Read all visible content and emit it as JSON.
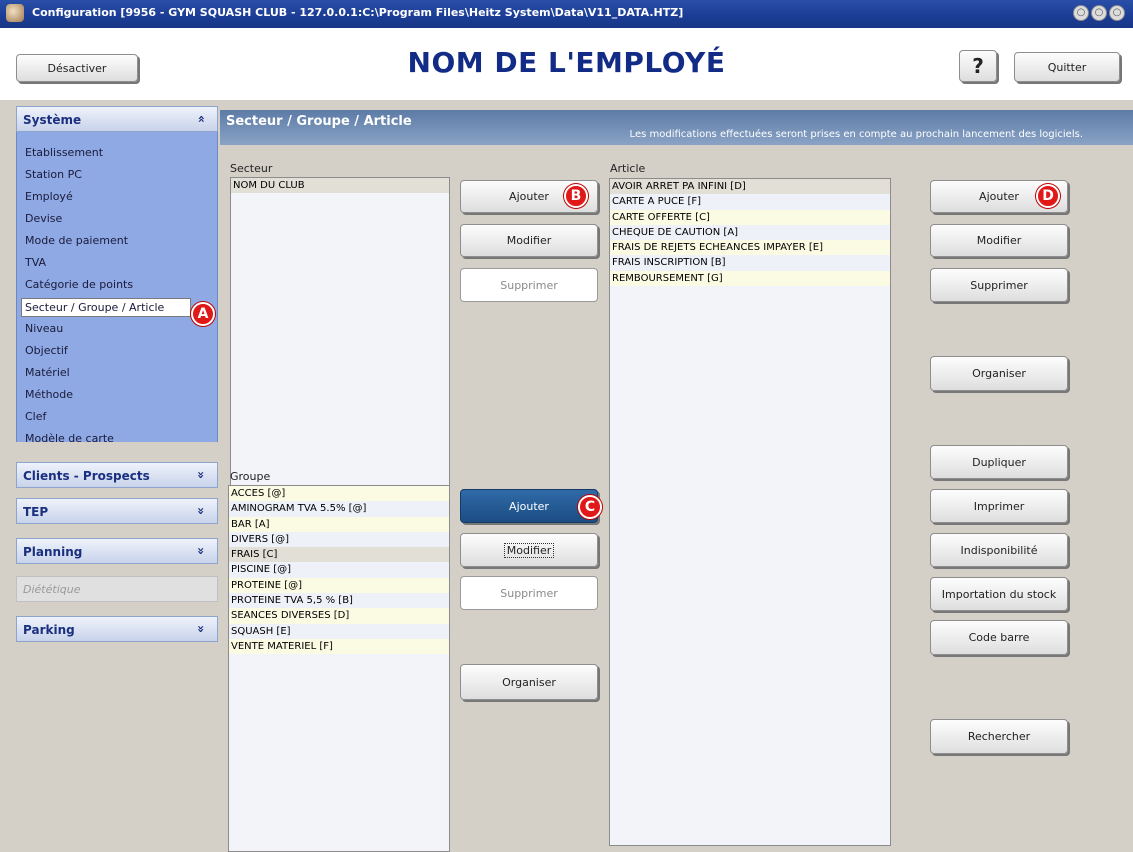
{
  "window": {
    "title": "Configuration [9956 - GYM SQUASH CLUB - 127.0.0.1:C:\\Program Files\\Heitz System\\Data\\V11_DATA.HTZ]",
    "controls": [
      "○",
      "○",
      "○"
    ]
  },
  "header": {
    "deactivate_label": "Désactiver",
    "heading": "NOM DE L'EMPLOYÉ",
    "help_label": "?",
    "quit_label": "Quitter"
  },
  "sidebar": {
    "systeme": {
      "label": "Système",
      "chevron": "»"
    },
    "items": [
      "Etablissement",
      "Station PC",
      "Employé",
      "Devise",
      "Mode de paiement",
      "TVA",
      "Catégorie de points",
      "Secteur / Groupe / Article",
      "Niveau",
      "Objectif",
      "Matériel",
      "Méthode",
      "Clef",
      "Modèle de carte"
    ],
    "selected_index": 7,
    "sections": [
      {
        "label": "Clients - Prospects",
        "chevron": "»"
      },
      {
        "label": "TEP",
        "chevron": "»"
      },
      {
        "label": "Planning",
        "chevron": "»"
      },
      {
        "label": "Diététique",
        "chevron": ""
      },
      {
        "label": "Parking",
        "chevron": "»"
      }
    ]
  },
  "main": {
    "banner_title": "Secteur / Groupe / Article",
    "banner_note": "Les modifications effectuées seront prises en compte au prochain lancement des logiciels.",
    "secteur": {
      "label": "Secteur",
      "items": [
        "NOM DU CLUB"
      ],
      "add": "Ajouter",
      "edit": "Modifier",
      "delete": "Supprimer"
    },
    "groupe": {
      "label": "Groupe",
      "items": [
        "ACCES [@]",
        "AMINOGRAM TVA 5.5% [@]",
        "BAR [A]",
        "DIVERS [@]",
        "FRAIS [C]",
        "PISCINE [@]",
        "PROTEINE [@]",
        "PROTEINE TVA 5,5 % [B]",
        "SEANCES DIVERSES [D]",
        "SQUASH [E]",
        "VENTE MATERIEL [F]"
      ],
      "selected_index": 4,
      "add": "Ajouter",
      "edit": "Modifier",
      "delete": "Supprimer",
      "organize": "Organiser"
    },
    "article": {
      "label": "Article",
      "items": [
        "AVOIR ARRET PA INFINI [D]",
        "CARTE A PUCE [F]",
        "CARTE OFFERTE [C]",
        "CHEQUE DE CAUTION [A]",
        "FRAIS DE REJETS ECHEANCES IMPAYER [E]",
        "FRAIS INSCRIPTION [B]",
        "REMBOURSEMENT [G]"
      ],
      "add": "Ajouter",
      "edit": "Modifier",
      "delete": "Supprimer",
      "organize": "Organiser",
      "duplicate": "Dupliquer",
      "print": "Imprimer",
      "unavailability": "Indisponibilité",
      "import_stock": "Importation du stock",
      "barcode": "Code barre",
      "search": "Rechercher"
    }
  },
  "markers": {
    "a": "A",
    "b": "B",
    "c": "C",
    "d": "D"
  },
  "colors": {
    "heading": "#122b86",
    "titlebar": "#1b3c95",
    "sidebar_list": "#8fa9e4",
    "marker": "#e01818",
    "active_button": "#1c4d83"
  }
}
